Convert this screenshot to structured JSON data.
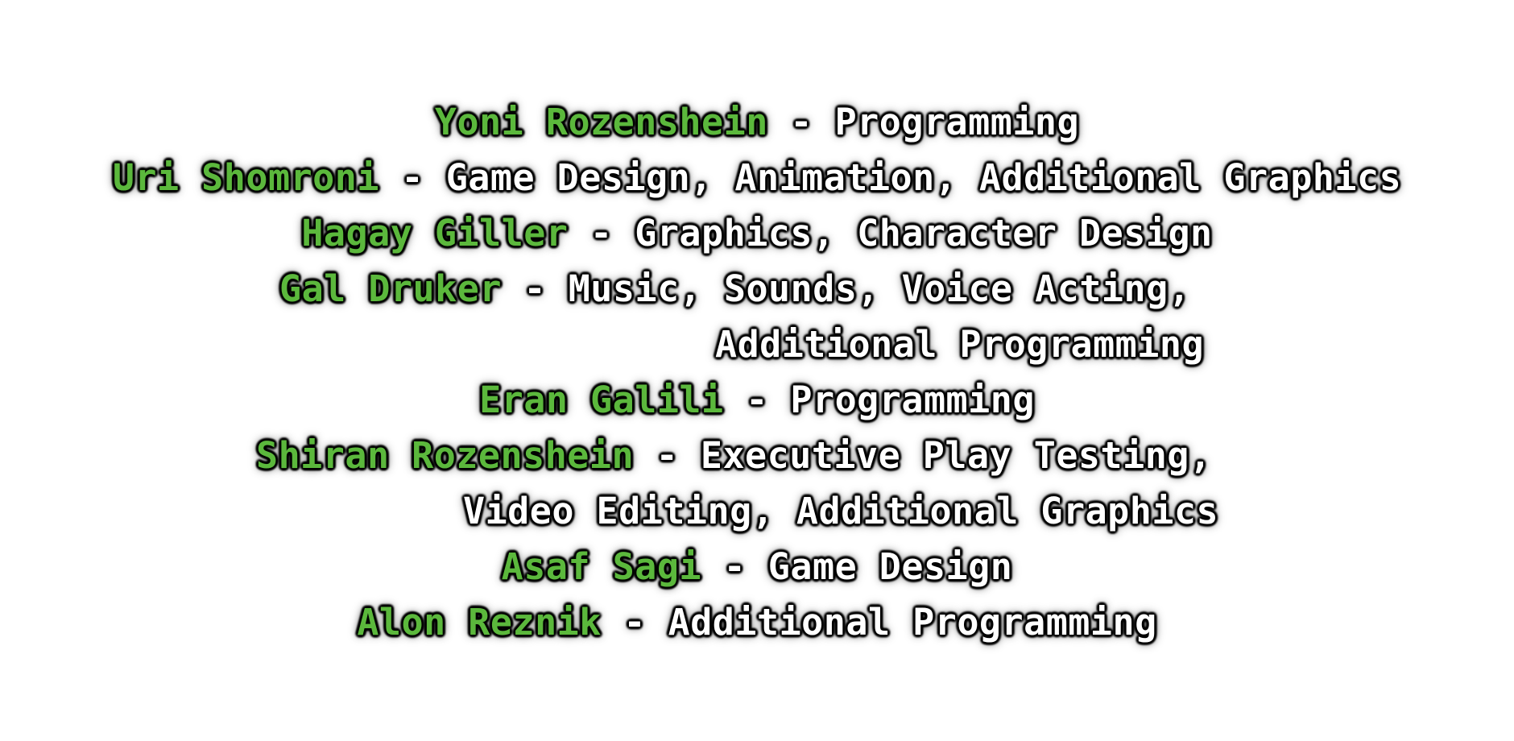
{
  "colors": {
    "name": "#5bb83c",
    "role": "#ffffff",
    "outline": "#000000",
    "background": "#ffffff"
  },
  "separator": " - ",
  "credits": [
    {
      "name": "Yoni Rozenshein",
      "role": "Programming"
    },
    {
      "name": "Uri Shomroni",
      "role": "Game Design, Animation, Additional Graphics"
    },
    {
      "name": "Hagay Giller",
      "role": "Graphics, Character Design"
    },
    {
      "name": "Gal Druker",
      "role": "Music, Sounds, Voice Acting,",
      "role_cont": "Additional Programming"
    },
    {
      "name": "Eran Galili",
      "role": "Programming"
    },
    {
      "name": "Shiran Rozenshein",
      "role": "Executive Play Testing,",
      "role_cont": "Video Editing, Additional Graphics"
    },
    {
      "name": "Asaf Sagi",
      "role": "Game Design"
    },
    {
      "name": "Alon Reznik",
      "role": "Additional Programming"
    }
  ]
}
